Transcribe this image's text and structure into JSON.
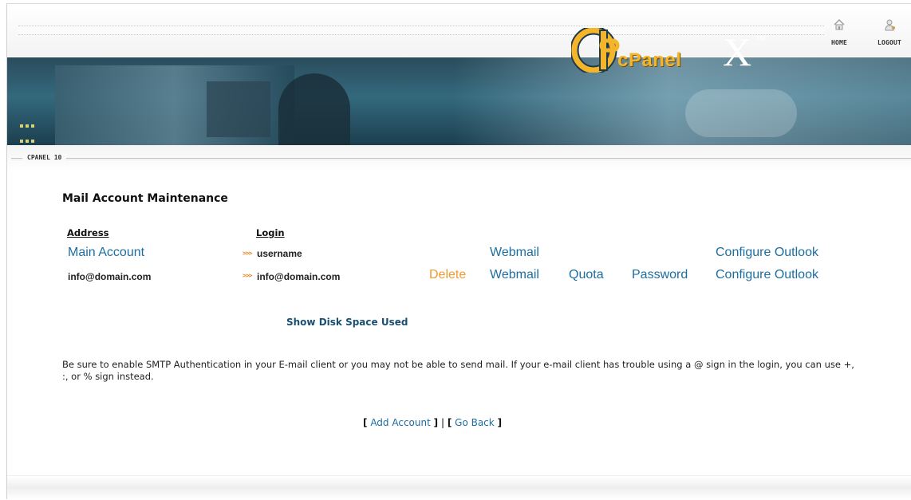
{
  "nav": {
    "home_label": "HOME",
    "logout_label": "LOGOUT",
    "home_icon": "home-icon",
    "logout_icon": "user-icon"
  },
  "banner": {
    "logo_text": "cPanel",
    "x_mark": "X",
    "tm": "TM"
  },
  "version_label": "CPANEL 10",
  "page_title": "Mail Account Maintenance",
  "table": {
    "headers": {
      "address": "Address",
      "login": "Login"
    },
    "rows": [
      {
        "address": "Main Account",
        "login": "username",
        "actions": {
          "delete": "",
          "webmail": "Webmail",
          "quota": "",
          "password": "",
          "configure_outlook": "Configure Outlook"
        }
      },
      {
        "address": "info@domain.com",
        "login": "info@domain.com",
        "actions": {
          "delete": "Delete",
          "webmail": "Webmail",
          "quota": "Quota",
          "password": "Password",
          "configure_outlook": "Configure Outlook"
        }
      }
    ],
    "arrow": ">>>"
  },
  "disk_link": "Show Disk Space Used",
  "notice": "Be sure to enable SMTP Authentication in your E-mail client or you may not be able to send mail. If your e-mail client has trouble using a @ sign in the login, you can use +, :, or % sign instead.",
  "footer": {
    "open": "[",
    "close": "]",
    "sep": "|",
    "add_account": "Add Account",
    "go_back": "Go Back"
  },
  "colors": {
    "link": "#1c6ea0",
    "delete": "#f09a2e",
    "banner": "#2a4c5c",
    "logo_text": "#f5b52a"
  }
}
